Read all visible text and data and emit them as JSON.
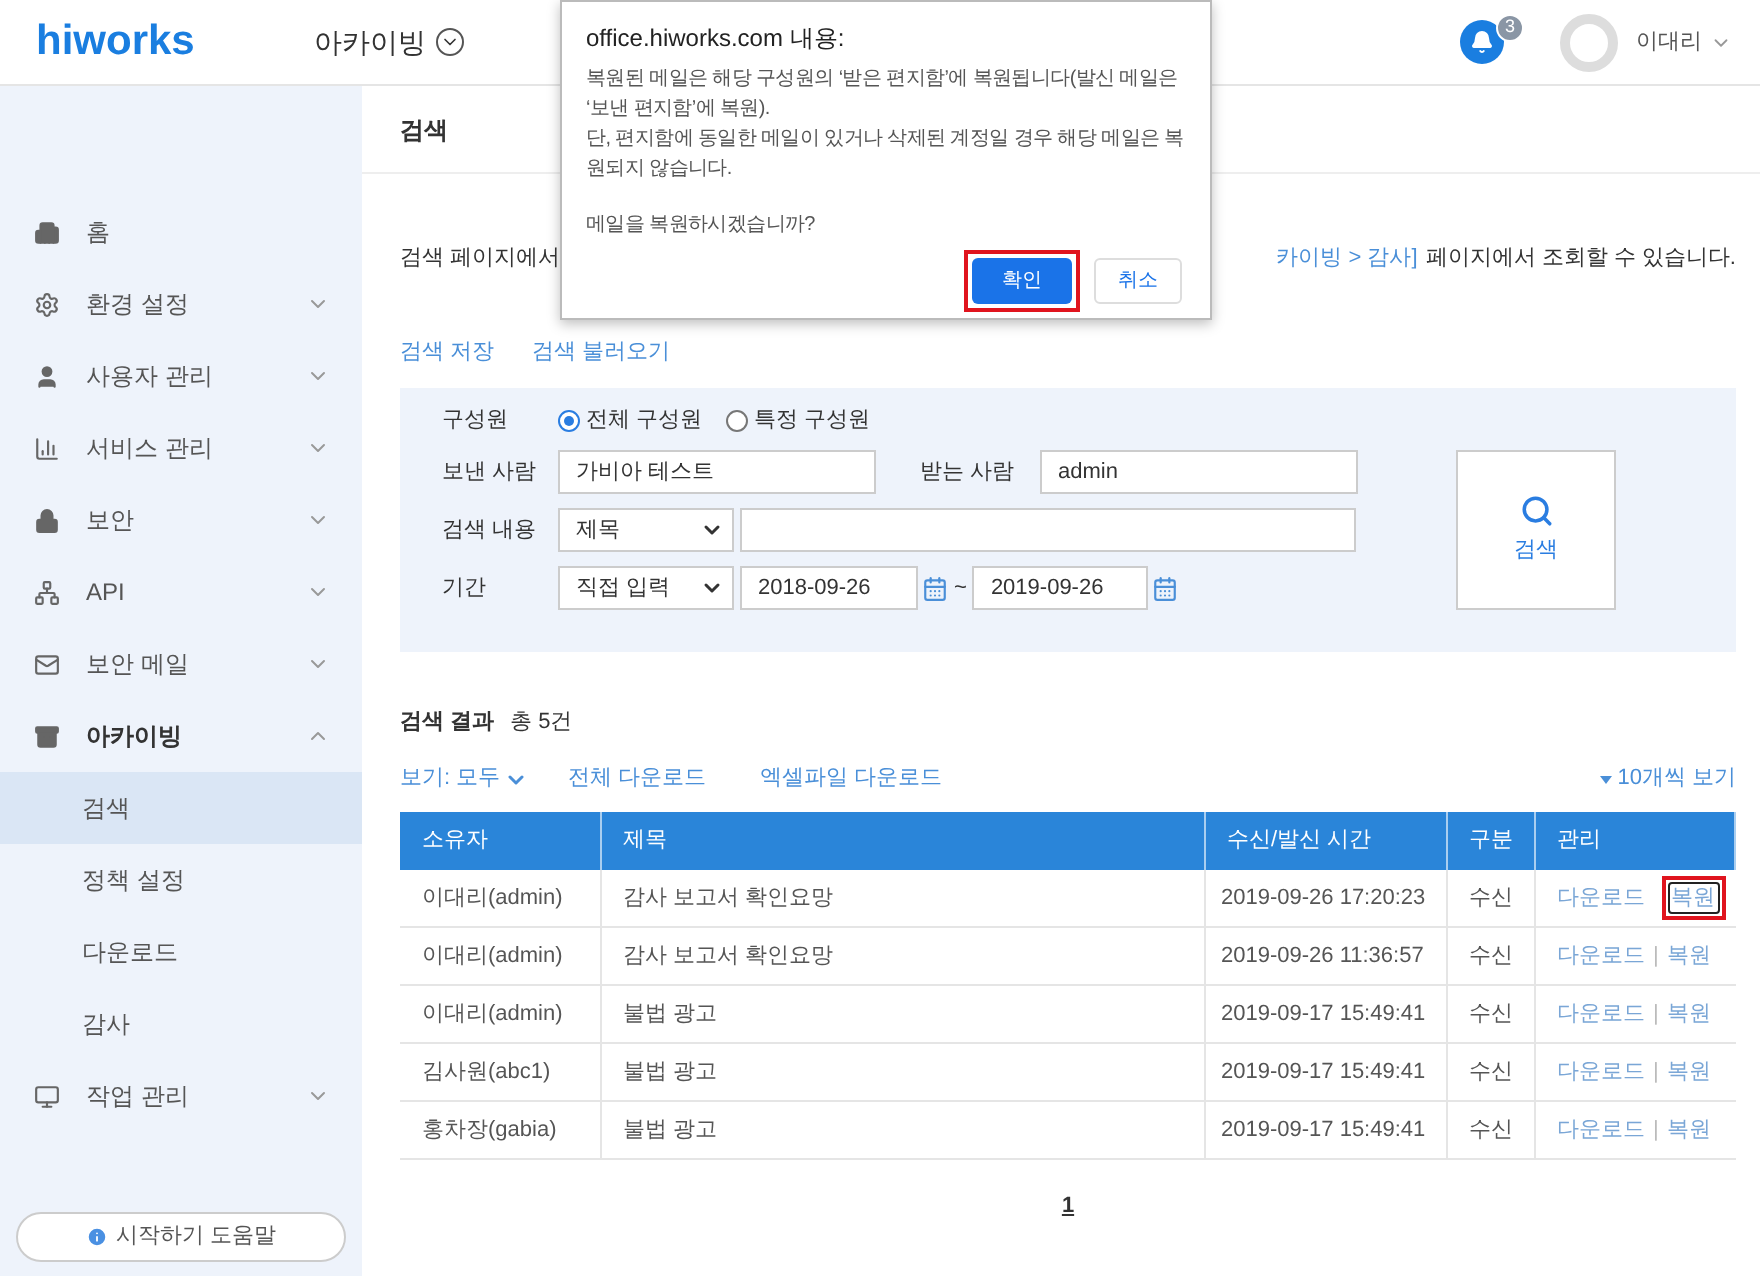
{
  "header": {
    "logo": "hiworks",
    "section": "아카이빙",
    "notification_count": "3",
    "user": "이대리"
  },
  "sidebar": {
    "items": [
      {
        "label": "홈"
      },
      {
        "label": "환경 설정",
        "expanded": false
      },
      {
        "label": "사용자 관리",
        "expanded": false
      },
      {
        "label": "서비스 관리",
        "expanded": false
      },
      {
        "label": "보안",
        "expanded": false
      },
      {
        "label": "API",
        "expanded": false
      },
      {
        "label": "보안 메일",
        "expanded": false
      },
      {
        "label": "아카이빙",
        "expanded": true,
        "children": [
          {
            "label": "검색",
            "selected": true
          },
          {
            "label": "정책 설정",
            "selected": false
          },
          {
            "label": "다운로드",
            "selected": false
          },
          {
            "label": "감사",
            "selected": false
          }
        ]
      },
      {
        "label": "작업 관리",
        "expanded": false
      }
    ],
    "help_button": "시작하기 도움말"
  },
  "page": {
    "title": "검색",
    "intro_left": "검색 페이지에서",
    "intro_link": "카이빙 > 감사]",
    "intro_right": "페이지에서 조회할 수 있습니다.",
    "links": [
      "검색 저장",
      "검색 불러오기"
    ],
    "search_form": {
      "member_label": "구성원",
      "member_options": [
        {
          "label": "전체 구성원",
          "selected": true
        },
        {
          "label": "특정 구성원",
          "selected": false
        }
      ],
      "sender_label": "보낸 사람",
      "sender_value": "가비아 테스트",
      "recipient_label": "받는 사람",
      "recipient_value": "admin",
      "content_label": "검색 내용",
      "content_select": "제목",
      "period_label": "기간",
      "period_select": "직접 입력",
      "date_from": "2018-09-26",
      "date_separator": "~",
      "date_to": "2019-09-26",
      "search_button": "검색"
    },
    "results": {
      "title": "검색 결과",
      "count": "총 5건",
      "view_filter": "보기: 모두",
      "download_all": "전체 다운로드",
      "excel_download": "엑셀파일 다운로드",
      "page_size": "10개씩 보기",
      "columns": [
        "소유자",
        "제목",
        "수신/발신 시간",
        "구분",
        "관리"
      ],
      "rows": [
        {
          "owner": "이대리(admin)",
          "subject": "감사 보고서 확인요망",
          "time": "2019-09-26 17:20:23",
          "type": "수신",
          "download": "다운로드",
          "restore": "복원",
          "restore_highlighted": true
        },
        {
          "owner": "이대리(admin)",
          "subject": "감사 보고서 확인요망",
          "time": "2019-09-26 11:36:57",
          "type": "수신",
          "download": "다운로드",
          "separator": "|",
          "restore": "복원",
          "restore_highlighted": false
        },
        {
          "owner": "이대리(admin)",
          "subject": "불법 광고",
          "time": "2019-09-17 15:49:41",
          "type": "수신",
          "download": "다운로드",
          "separator": "|",
          "restore": "복원",
          "restore_highlighted": false
        },
        {
          "owner": "김사원(abc1)",
          "subject": "불법 광고",
          "time": "2019-09-17 15:49:41",
          "type": "수신",
          "download": "다운로드",
          "separator": "|",
          "restore": "복원",
          "restore_highlighted": false
        },
        {
          "owner": "홍차장(gabia)",
          "subject": "불법 광고",
          "time": "2019-09-17 15:49:41",
          "type": "수신",
          "download": "다운로드",
          "separator": "|",
          "restore": "복원",
          "restore_highlighted": false
        }
      ],
      "pagination": [
        {
          "label": "1",
          "selected": true
        }
      ]
    }
  },
  "dialog": {
    "title": "office.hiworks.com 내용:",
    "message": [
      "복원된 메일은 해당 구성원의 ‘받은 편지함’에 복원됩니다(발신 메일은 ‘보낸 편지함’에 복원).",
      "단, 편지함에 동일한 메일이 있거나 삭제된 계정일 경우 해당 메일은 복원되지 않습니다."
    ],
    "question": "메일을 복원하시겠습니까?",
    "buttons": [
      {
        "label": "확인",
        "kind": "primary",
        "highlighted": true
      },
      {
        "label": "취소",
        "kind": "secondary",
        "highlighted": false
      }
    ]
  }
}
